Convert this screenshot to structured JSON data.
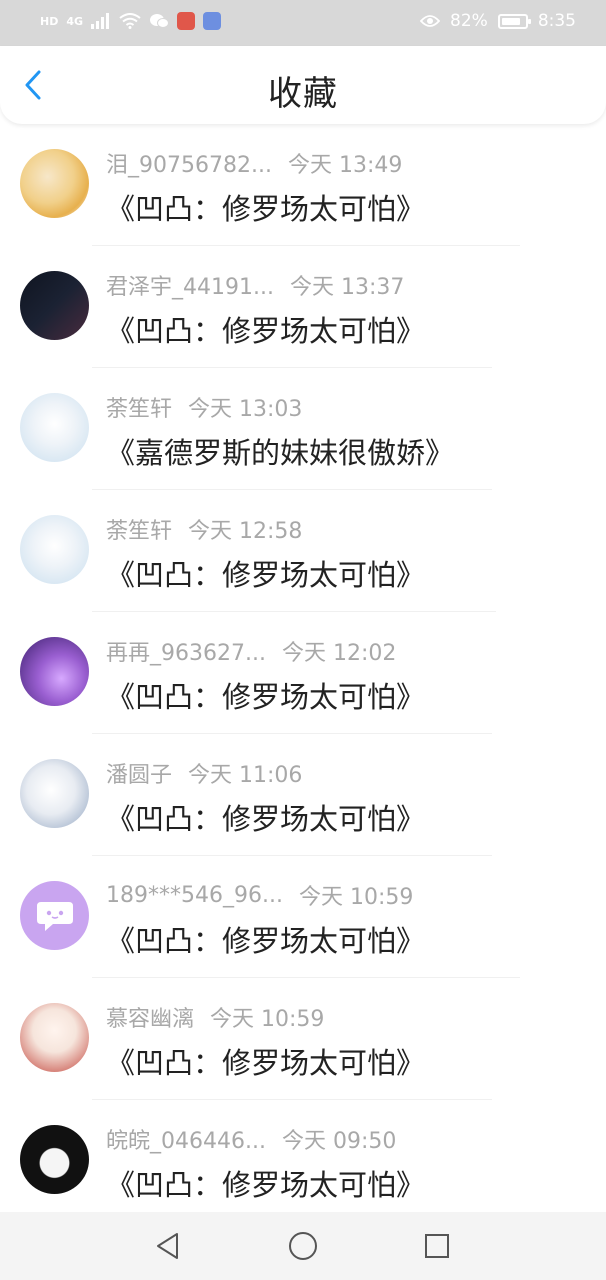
{
  "status_bar": {
    "left_labels": [
      "HD",
      "4G"
    ],
    "battery": "82%",
    "time": "8:35"
  },
  "header": {
    "title": "收藏",
    "back_icon": "chevron-left-icon",
    "accent_color": "#2196f3"
  },
  "items": [
    {
      "name": "泪_90756782...",
      "time": "今天 13:49",
      "title": "《凹凸：修罗场太可怕》",
      "avatar_colors": [
        "#f7e7c9",
        "#e7b04e"
      ]
    },
    {
      "name": "君泽宇_44191...",
      "time": "今天 13:37",
      "title": "《凹凸：修罗场太可怕》",
      "avatar_colors": [
        "#1b2233",
        "#4a2b3e"
      ]
    },
    {
      "name": "荼笙轩",
      "time": "今天 13:03",
      "title": "《嘉德罗斯的妹妹很傲娇》",
      "avatar_colors": [
        "#c9dfef",
        "#eef3f8"
      ]
    },
    {
      "name": "荼笙轩",
      "time": "今天 12:58",
      "title": "《凹凸：修罗场太可怕》",
      "avatar_colors": [
        "#c9dfef",
        "#eef3f8"
      ]
    },
    {
      "name": "再再_963627...",
      "time": "今天 12:02",
      "title": "《凹凸：修罗场太可怕》",
      "avatar_colors": [
        "#3a1e6b",
        "#9a5fd1"
      ]
    },
    {
      "name": "潘圆子",
      "time": "今天 11:06",
      "title": "《凹凸：修罗场太可怕》",
      "avatar_colors": [
        "#e8ecf2",
        "#8fa3c0"
      ]
    },
    {
      "name": "189***546_96...",
      "time": "今天 10:59",
      "title": "《凹凸：修罗场太可怕》",
      "avatar_colors": [
        "#c9a5f0",
        "#c9a5f0"
      ]
    },
    {
      "name": "慕容幽漓",
      "time": "今天 10:59",
      "title": "《凹凸：修罗场太可怕》",
      "avatar_colors": [
        "#f6e5dc",
        "#c2433a"
      ]
    },
    {
      "name": "皖皖_046446...",
      "time": "今天 09:50",
      "title": "《凹凸：修罗场太可怕》",
      "avatar_colors": [
        "#111111",
        "#f5f5f5"
      ]
    }
  ],
  "nav_bar": {
    "buttons": [
      "back-triangle-icon",
      "home-circle-icon",
      "recents-square-icon"
    ]
  }
}
